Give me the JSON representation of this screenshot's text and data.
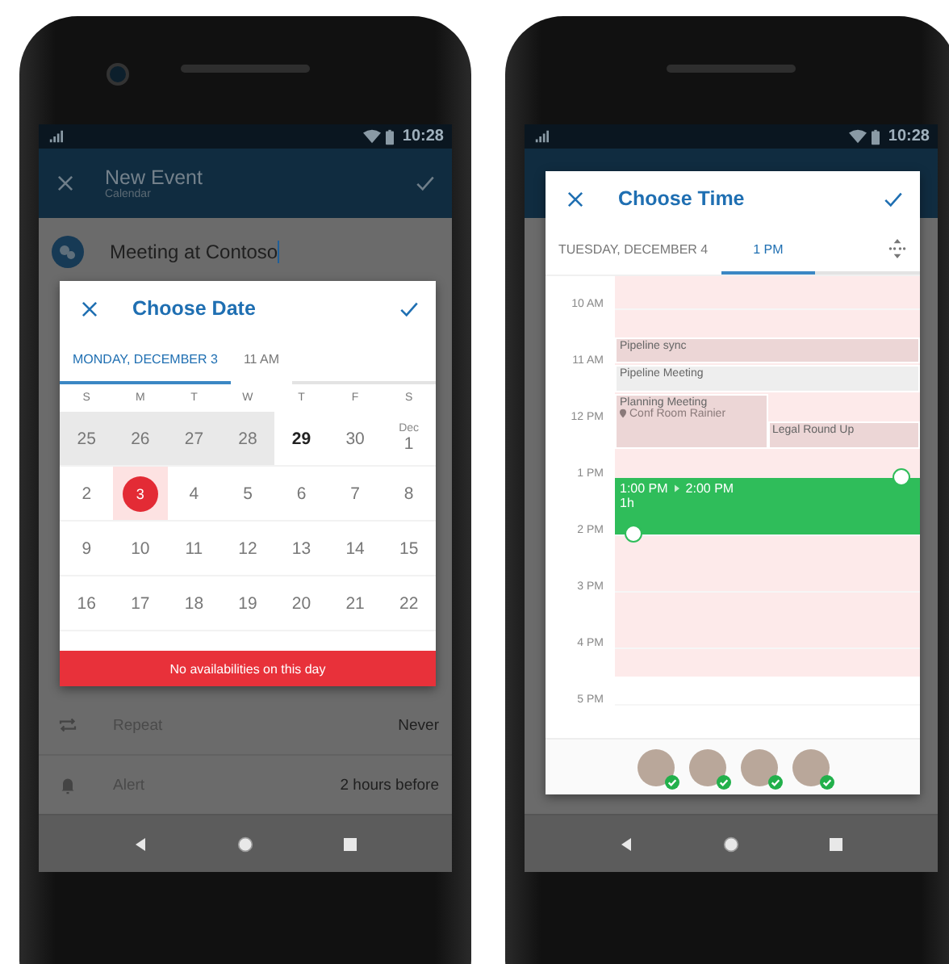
{
  "left_phone": {
    "status_bar": {
      "time": "10:28"
    },
    "app_bar": {
      "title": "New Event",
      "subtitle": "Calendar"
    },
    "event_title": "Meeting at Contoso",
    "date_dialog": {
      "title": "Choose Date",
      "tabs": [
        {
          "label": "MONDAY, DECEMBER 3",
          "selected": true
        },
        {
          "label": "11 AM",
          "selected": false
        }
      ],
      "weekdays": [
        "S",
        "M",
        "T",
        "W",
        "T",
        "F",
        "S"
      ],
      "weeks": [
        [
          {
            "label": "25",
            "past": true,
            "today": false,
            "selected": false
          },
          {
            "label": "26",
            "past": true,
            "today": false,
            "selected": false
          },
          {
            "label": "27",
            "past": true,
            "today": false,
            "selected": false
          },
          {
            "label": "28",
            "past": true,
            "today": false,
            "selected": false
          },
          {
            "label": "29",
            "past": false,
            "today": true,
            "selected": false
          },
          {
            "label": "30",
            "past": false,
            "today": false,
            "selected": false
          },
          {
            "label": "1",
            "month": "Dec",
            "past": false,
            "today": false,
            "selected": false
          }
        ],
        [
          {
            "label": "2",
            "past": false,
            "today": false,
            "selected": false
          },
          {
            "label": "3",
            "past": false,
            "today": false,
            "selected": true
          },
          {
            "label": "4",
            "past": false,
            "today": false,
            "selected": false
          },
          {
            "label": "5",
            "past": false,
            "today": false,
            "selected": false
          },
          {
            "label": "6",
            "past": false,
            "today": false,
            "selected": false
          },
          {
            "label": "7",
            "past": false,
            "today": false,
            "selected": false
          },
          {
            "label": "8",
            "past": false,
            "today": false,
            "selected": false
          }
        ],
        [
          {
            "label": "9",
            "past": false,
            "today": false,
            "selected": false
          },
          {
            "label": "10",
            "past": false,
            "today": false,
            "selected": false
          },
          {
            "label": "11",
            "past": false,
            "today": false,
            "selected": false
          },
          {
            "label": "12",
            "past": false,
            "today": false,
            "selected": false
          },
          {
            "label": "13",
            "past": false,
            "today": false,
            "selected": false
          },
          {
            "label": "14",
            "past": false,
            "today": false,
            "selected": false
          },
          {
            "label": "15",
            "past": false,
            "today": false,
            "selected": false
          }
        ],
        [
          {
            "label": "16",
            "past": false,
            "today": false,
            "selected": false
          },
          {
            "label": "17",
            "past": false,
            "today": false,
            "selected": false
          },
          {
            "label": "18",
            "past": false,
            "today": false,
            "selected": false
          },
          {
            "label": "19",
            "past": false,
            "today": false,
            "selected": false
          },
          {
            "label": "20",
            "past": false,
            "today": false,
            "selected": false
          },
          {
            "label": "21",
            "past": false,
            "today": false,
            "selected": false
          },
          {
            "label": "22",
            "past": false,
            "today": false,
            "selected": false
          }
        ]
      ],
      "banner": "No availabilities on this day"
    },
    "rows": [
      {
        "kind": "repeat",
        "label": "Repeat",
        "value": "Never"
      },
      {
        "kind": "alert",
        "label": "Alert",
        "value": "2 hours before"
      }
    ]
  },
  "right_phone": {
    "status_bar": {
      "time": "10:28"
    },
    "time_dialog": {
      "title": "Choose Time",
      "tabs": [
        {
          "label": "TUESDAY, DECEMBER 4",
          "selected": false
        },
        {
          "label": "1 PM",
          "selected": true
        }
      ],
      "hours": [
        "10 AM",
        "11 AM",
        "12 PM",
        "1 PM",
        "2 PM",
        "3 PM",
        "4 PM",
        "5 PM"
      ],
      "events": [
        {
          "title": "Pipeline sync",
          "kind": "full",
          "color": "#ecd6d6"
        },
        {
          "title": "Pipeline Meeting",
          "kind": "full",
          "color": "#eeeeee"
        },
        {
          "title": "Planning Meeting",
          "location": "Conf Room Rainier",
          "kind": "left",
          "color": "#ecd6d6"
        },
        {
          "title": "Legal Round Up",
          "kind": "right",
          "color": "#ecd6d6"
        }
      ],
      "selection": {
        "start_label": "1:00 PM",
        "end_label": "2:00 PM",
        "duration": "1h"
      },
      "attendees": [
        {
          "accepted": true
        },
        {
          "accepted": true
        },
        {
          "accepted": true
        },
        {
          "accepted": true
        }
      ]
    }
  }
}
